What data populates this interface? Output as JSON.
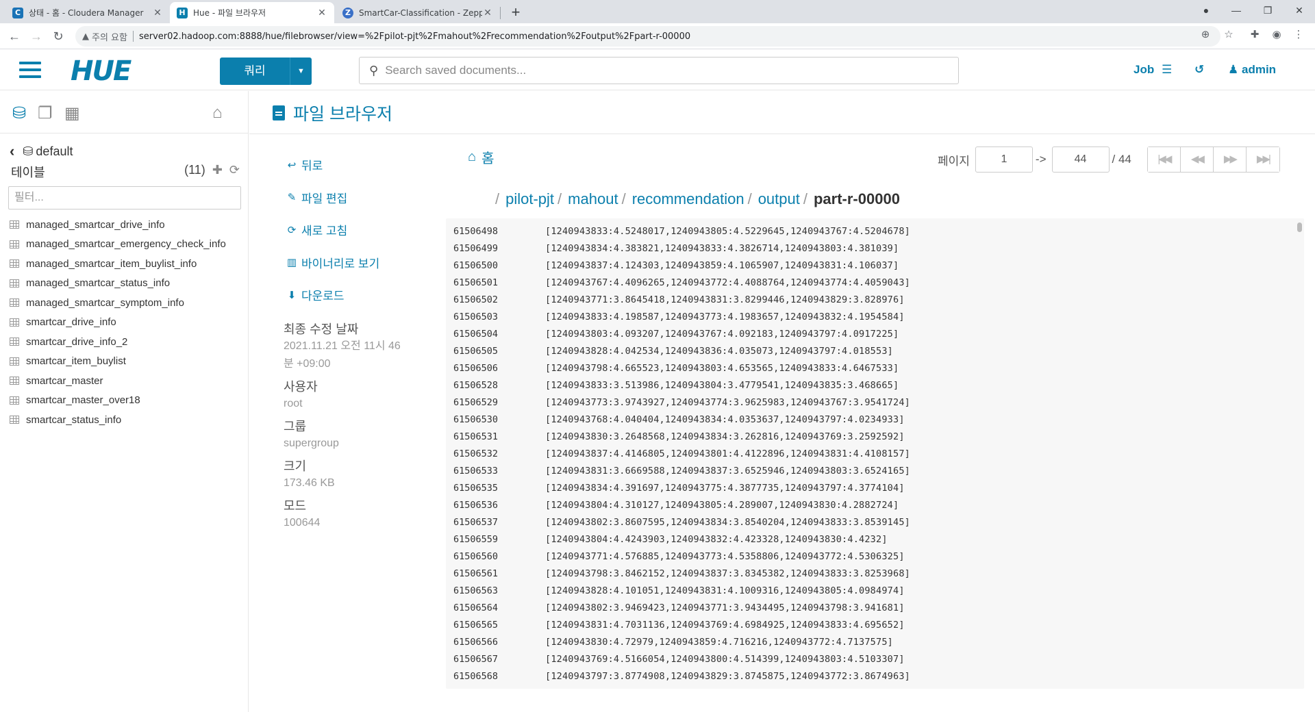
{
  "browser": {
    "tabs": [
      {
        "title": "상태 - 홈 - Cloudera Manager",
        "favicon": "C",
        "favicon_color": "#1a73b6"
      },
      {
        "title": "Hue - 파일 브라우저",
        "favicon": "H",
        "favicon_color": "#0b7fad"
      },
      {
        "title": "SmartCar-Classification - Zeppe",
        "favicon": "Z",
        "favicon_color": "#3a70c7"
      }
    ],
    "security_label": "주의 요함",
    "url": "server02.hadoop.com:8888/hue/filebrowser/view=%2Fpilot-pjt%2Fmahout%2Frecommendation%2Foutput%2Fpart-r-00000"
  },
  "header": {
    "logo": "HUE",
    "query_label": "쿼리",
    "search_placeholder": "Search saved documents...",
    "job_label": "Job",
    "user_label": "admin"
  },
  "sidebar": {
    "database": "default",
    "tables_label": "테이블",
    "table_count": "(11)",
    "filter_placeholder": "필터...",
    "tables": [
      "managed_smartcar_drive_info",
      "managed_smartcar_emergency_check_info",
      "managed_smartcar_item_buylist_info",
      "managed_smartcar_status_info",
      "managed_smartcar_symptom_info",
      "smartcar_drive_info",
      "smartcar_drive_info_2",
      "smartcar_item_buylist",
      "smartcar_master",
      "smartcar_master_over18",
      "smartcar_status_info"
    ]
  },
  "main": {
    "title": "파일 브라우저",
    "actions": [
      "뒤로",
      "파일 편집",
      "새로 고침",
      "바이너리로 보기",
      "다운로드"
    ],
    "meta": [
      {
        "label": "최종 수정 날짜",
        "value": "2021.11.21 오전 11시 46분 +09:00"
      },
      {
        "label": "사용자",
        "value": "root"
      },
      {
        "label": "그룹",
        "value": "supergroup"
      },
      {
        "label": "크기",
        "value": "173.46 KB"
      },
      {
        "label": "모드",
        "value": "100644"
      }
    ],
    "home_label": "홈",
    "pager": {
      "label": "페이지",
      "from": "1",
      "arrow": "->",
      "to": "44",
      "total": "/ 44"
    },
    "breadcrumb": [
      "pilot-pjt",
      "mahout",
      "recommendation",
      "output",
      "part-r-00000"
    ],
    "rows": [
      {
        "key": "61506498",
        "value": "[1240943833:4.5248017,1240943805:4.5229645,1240943767:4.5204678]"
      },
      {
        "key": "61506499",
        "value": "[1240943834:4.383821,1240943833:4.3826714,1240943803:4.381039]"
      },
      {
        "key": "61506500",
        "value": "[1240943837:4.124303,1240943859:4.1065907,1240943831:4.106037]"
      },
      {
        "key": "61506501",
        "value": "[1240943767:4.4096265,1240943772:4.4088764,1240943774:4.4059043]"
      },
      {
        "key": "61506502",
        "value": "[1240943771:3.8645418,1240943831:3.8299446,1240943829:3.828976]"
      },
      {
        "key": "61506503",
        "value": "[1240943833:4.198587,1240943773:4.1983657,1240943832:4.1954584]"
      },
      {
        "key": "61506504",
        "value": "[1240943803:4.093207,1240943767:4.092183,1240943797:4.0917225]"
      },
      {
        "key": "61506505",
        "value": "[1240943828:4.042534,1240943836:4.035073,1240943797:4.018553]"
      },
      {
        "key": "61506506",
        "value": "[1240943798:4.665523,1240943803:4.653565,1240943833:4.6467533]"
      },
      {
        "key": "61506528",
        "value": "[1240943833:3.513986,1240943804:3.4779541,1240943835:3.468665]"
      },
      {
        "key": "61506529",
        "value": "[1240943773:3.9743927,1240943774:3.9625983,1240943767:3.9541724]"
      },
      {
        "key": "61506530",
        "value": "[1240943768:4.040404,1240943834:4.0353637,1240943797:4.0234933]"
      },
      {
        "key": "61506531",
        "value": "[1240943830:3.2648568,1240943834:3.262816,1240943769:3.2592592]"
      },
      {
        "key": "61506532",
        "value": "[1240943837:4.4146805,1240943801:4.4122896,1240943831:4.4108157]"
      },
      {
        "key": "61506533",
        "value": "[1240943831:3.6669588,1240943837:3.6525946,1240943803:3.6524165]"
      },
      {
        "key": "61506535",
        "value": "[1240943834:4.391697,1240943775:4.3877735,1240943797:4.3774104]"
      },
      {
        "key": "61506536",
        "value": "[1240943804:4.310127,1240943805:4.289007,1240943830:4.2882724]"
      },
      {
        "key": "61506537",
        "value": "[1240943802:3.8607595,1240943834:3.8540204,1240943833:3.8539145]"
      },
      {
        "key": "61506559",
        "value": "[1240943804:4.4243903,1240943832:4.423328,1240943830:4.4232]"
      },
      {
        "key": "61506560",
        "value": "[1240943771:4.576885,1240943773:4.5358806,1240943772:4.5306325]"
      },
      {
        "key": "61506561",
        "value": "[1240943798:3.8462152,1240943837:3.8345382,1240943833:3.8253968]"
      },
      {
        "key": "61506563",
        "value": "[1240943828:4.101051,1240943831:4.1009316,1240943805:4.0984974]"
      },
      {
        "key": "61506564",
        "value": "[1240943802:3.9469423,1240943771:3.9434495,1240943798:3.941681]"
      },
      {
        "key": "61506565",
        "value": "[1240943831:4.7031136,1240943769:4.6984925,1240943833:4.695652]"
      },
      {
        "key": "61506566",
        "value": "[1240943830:4.72979,1240943859:4.716216,1240943772:4.7137575]"
      },
      {
        "key": "61506567",
        "value": "[1240943769:4.5166054,1240943800:4.514399,1240943803:4.5103307]"
      },
      {
        "key": "61506568",
        "value": "[1240943797:3.8774908,1240943829:3.8745875,1240943772:3.8674963]"
      }
    ]
  }
}
